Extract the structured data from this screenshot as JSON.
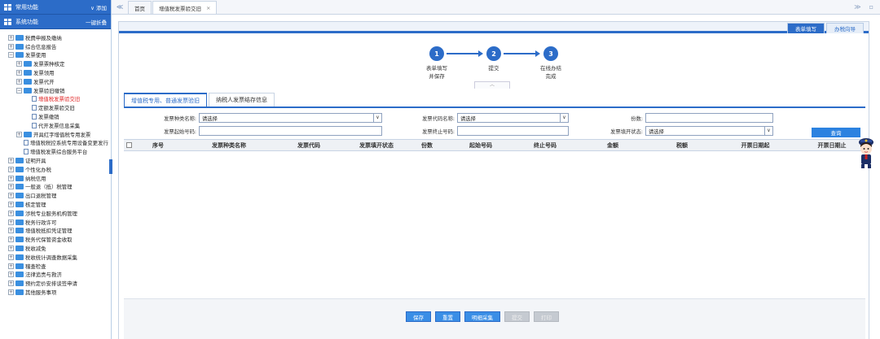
{
  "sidebar": {
    "header1": {
      "title": "常用功能",
      "action": "∨ 添加"
    },
    "header2": {
      "title": "系统功能",
      "action": "一键折叠"
    },
    "items": [
      {
        "label": "税费申报及缴纳",
        "level": 0,
        "type": "folder",
        "toggle": "+"
      },
      {
        "label": "综合信息报告",
        "level": 0,
        "type": "folder",
        "toggle": "+"
      },
      {
        "label": "发票使用",
        "level": 0,
        "type": "folder-open",
        "toggle": "−"
      },
      {
        "label": "发票票种核定",
        "level": 1,
        "type": "folder",
        "toggle": "+"
      },
      {
        "label": "发票领用",
        "level": 1,
        "type": "folder",
        "toggle": "+"
      },
      {
        "label": "发票代开",
        "level": 1,
        "type": "folder",
        "toggle": "+"
      },
      {
        "label": "发票验旧缴销",
        "level": 1,
        "type": "folder-open",
        "toggle": "−"
      },
      {
        "label": "增值税发票验交旧",
        "level": 2,
        "type": "doc",
        "selected": true
      },
      {
        "label": "定额发票验交旧",
        "level": 2,
        "type": "doc"
      },
      {
        "label": "发票缴销",
        "level": 2,
        "type": "doc"
      },
      {
        "label": "代开发票信息采集",
        "level": 2,
        "type": "doc"
      },
      {
        "label": "开具红字增值税专用发票",
        "level": 1,
        "type": "folder",
        "toggle": "+"
      },
      {
        "label": "增值税税控系统专用设备变更发行",
        "level": 1,
        "type": "doc"
      },
      {
        "label": "增值税发票综合服务平台",
        "level": 1,
        "type": "doc"
      },
      {
        "label": "证明开具",
        "level": 0,
        "type": "folder",
        "toggle": "+"
      },
      {
        "label": "个性化办税",
        "level": 0,
        "type": "folder",
        "toggle": "+"
      },
      {
        "label": "纳税信用",
        "level": 0,
        "type": "folder",
        "toggle": "+"
      },
      {
        "label": "一般退（抵）税管理",
        "level": 0,
        "type": "folder",
        "toggle": "+"
      },
      {
        "label": "出口退税管理",
        "level": 0,
        "type": "folder",
        "toggle": "+"
      },
      {
        "label": "核定管理",
        "level": 0,
        "type": "folder",
        "toggle": "+"
      },
      {
        "label": "涉税专业服务机构管理",
        "level": 0,
        "type": "folder",
        "toggle": "+"
      },
      {
        "label": "税务行政许可",
        "level": 0,
        "type": "folder",
        "toggle": "+"
      },
      {
        "label": "增值税抵扣凭证管理",
        "level": 0,
        "type": "folder",
        "toggle": "+"
      },
      {
        "label": "税务代保管资金收取",
        "level": 0,
        "type": "folder",
        "toggle": "+"
      },
      {
        "label": "税收减免",
        "level": 0,
        "type": "folder",
        "toggle": "+"
      },
      {
        "label": "税收统计调查数据采集",
        "level": 0,
        "type": "folder",
        "toggle": "+"
      },
      {
        "label": "稽查检查",
        "level": 0,
        "type": "folder",
        "toggle": "+"
      },
      {
        "label": "法律追责与救济",
        "level": 0,
        "type": "folder",
        "toggle": "+"
      },
      {
        "label": "预约定价安排谈签申请",
        "level": 0,
        "type": "folder",
        "toggle": "+"
      },
      {
        "label": "其他服务事项",
        "level": 0,
        "type": "folder",
        "toggle": "+"
      }
    ]
  },
  "topbar": {
    "nav_left": "≪",
    "tabs": [
      {
        "label": "首页"
      },
      {
        "label": "增值税发票验交旧",
        "close": "×"
      }
    ],
    "nav_right": "≫",
    "menu": "▫"
  },
  "mode_buttons": {
    "form": "表单填写",
    "guide": "办税向导"
  },
  "steps": [
    {
      "num": "1",
      "label_line1": "表单填写",
      "label_line2": "并保存"
    },
    {
      "num": "2",
      "label_line1": "提交",
      "label_line2": ""
    },
    {
      "num": "3",
      "label_line1": "在线办结",
      "label_line2": "完成"
    }
  ],
  "collapse_handle": "︿",
  "inner_tabs": [
    {
      "label": "增值税专用、普通发票验旧"
    },
    {
      "label": "纳税人发票结存信息"
    }
  ],
  "form": {
    "invoice_type_label": "发票种类名称:",
    "invoice_type_value": "请选择",
    "invoice_code_label": "发票代码名称:",
    "invoice_code_value": "请选择",
    "count_label": "份数:",
    "start_no_label": "发票起始号码:",
    "end_no_label": "发票终止号码:",
    "status_label": "发票填开状态:",
    "status_value": "请选择",
    "dropdown_glyph": "∨",
    "query_button": "查询"
  },
  "table": {
    "columns": [
      "序号",
      "发票种类名称",
      "发票代码",
      "发票填开状态",
      "份数",
      "起始号码",
      "终止号码",
      "金额",
      "税额",
      "开票日期起",
      "开票日期止"
    ]
  },
  "footer_buttons": [
    {
      "label": "保存",
      "enabled": true
    },
    {
      "label": "重置",
      "enabled": true
    },
    {
      "label": "明细采集",
      "enabled": true
    },
    {
      "label": "提交",
      "enabled": false
    },
    {
      "label": "打印",
      "enabled": false
    }
  ],
  "colors": {
    "accent": "#2c6cc8",
    "selected_text": "#e02020"
  }
}
